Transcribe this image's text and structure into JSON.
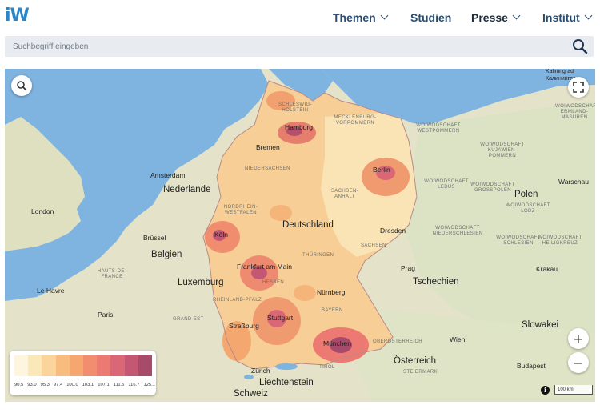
{
  "header": {
    "logo": "iW",
    "nav": [
      {
        "label": "Themen",
        "has_dropdown": true
      },
      {
        "label": "Studien",
        "has_dropdown": false
      },
      {
        "label": "Presse",
        "has_dropdown": true
      },
      {
        "label": "Institut",
        "has_dropdown": true
      }
    ]
  },
  "search": {
    "placeholder": "Suchbegriff eingeben",
    "icon": "search-icon"
  },
  "map": {
    "labels": {
      "germany": "Deutschland",
      "countries": [
        "Belgien",
        "Luxemburg",
        "Nederlande",
        "Polen",
        "Tschechien",
        "Slowakei",
        "Österreich",
        "Liechtenstein",
        "Schweiz"
      ],
      "cities": [
        "Amsterdam",
        "London",
        "Brüssel",
        "Paris",
        "Le Havre",
        "Hamburg",
        "Bremen",
        "Berlin",
        "Köln",
        "Frankfurt am Main",
        "Stuttgart",
        "München",
        "Nürnberg",
        "Dresden",
        "Prag",
        "Wien",
        "Krakau",
        "Warschau",
        "Budapest",
        "Zürich",
        "Straßburg",
        "Kaliningrad",
        "Калининград"
      ],
      "regions": [
        "SCHLESWIG-HOLSTEIN",
        "MECKLENBURG-VORPOMMERN",
        "NIEDERSACHSEN",
        "SACHSEN-ANHALT",
        "NORDRHEIN-WESTFALEN",
        "HESSEN",
        "RHEINLAND-PFALZ",
        "BAYERN",
        "THÜRINGEN",
        "SACHSEN",
        "OBERÖSTERREICH",
        "STEIERMARK",
        "TIROL",
        "HAUTS-DE-FRANCE",
        "GRAND EST",
        "WOIWODSCHAFT ERMLAND-MASUREN",
        "WOIWODSCHAFT WESTPOMMERN",
        "WOIWODSCHAFT KUJAWIEN-POMMERN",
        "WOIWODSCHAFT LEBUS",
        "WOIWODSCHAFT GROSSPOLEN",
        "WOIWODSCHAFT LÓDZ",
        "WOIWODSCHAFT NIEDERSCHLESIEN",
        "WOIWODSCHAFT SCHLESIEN",
        "WOIWODSCHAFT HEILIGKREUZ"
      ]
    },
    "legend": {
      "colors": [
        "#fdf5dd",
        "#fbe8b8",
        "#fad49a",
        "#f8bd7e",
        "#f6a66f",
        "#f28d6f",
        "#ec7a72",
        "#d96776",
        "#c35774",
        "#a84a6a"
      ],
      "values": [
        "90.5",
        "93.0",
        "95.3",
        "97.4",
        "100.0",
        "103.1",
        "107.1",
        "111.5",
        "116.7",
        "125.1"
      ]
    },
    "scale_label": "100 km",
    "controls": {
      "zoom_in": "+",
      "zoom_out": "−",
      "info": "i"
    }
  }
}
